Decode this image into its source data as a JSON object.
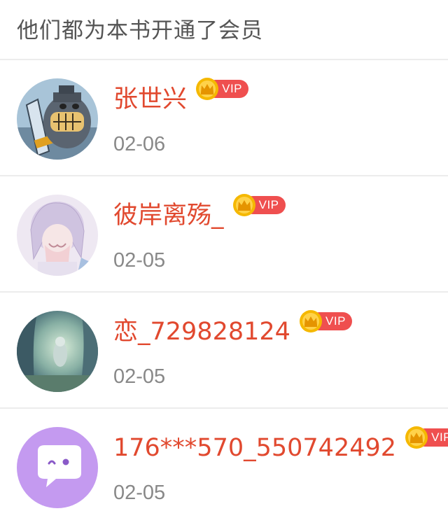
{
  "header": {
    "title": "他们都为本书开通了会员"
  },
  "members": [
    {
      "name": "张世兴",
      "date": "02-06",
      "vip_label": "VIP",
      "avatar_icon": "knight-cartoon-avatar"
    },
    {
      "name": "彼岸离殇_",
      "date": "02-05",
      "vip_label": "VIP",
      "avatar_icon": "anime-girl-avatar"
    },
    {
      "name": "恋_729828124",
      "date": "02-05",
      "vip_label": "VIP",
      "avatar_icon": "forest-scene-avatar"
    },
    {
      "name": "176***570_550742492",
      "date": "02-05",
      "vip_label": "VIP",
      "avatar_icon": "chat-bubble-avatar"
    }
  ],
  "colors": {
    "name": "#e1492f",
    "vip_pill": "#ef4f4f",
    "vip_crown": "#f5b800",
    "date": "#888888",
    "title": "#555555",
    "divider": "#ececec"
  }
}
